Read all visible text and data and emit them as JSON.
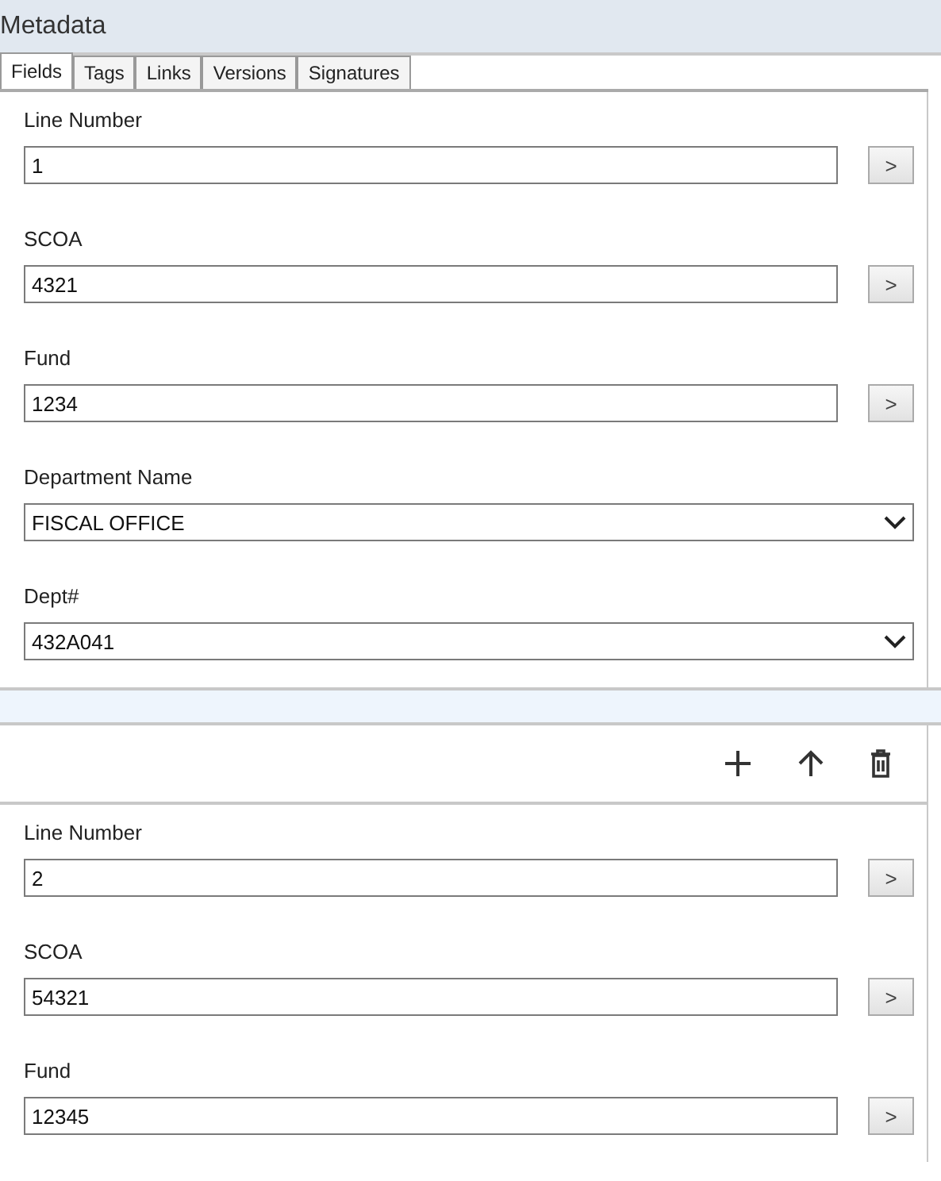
{
  "window": {
    "title": "Metadata"
  },
  "tabs": [
    {
      "label": "Fields",
      "selected": true
    },
    {
      "label": "Tags",
      "selected": false
    },
    {
      "label": "Links",
      "selected": false
    },
    {
      "label": "Versions",
      "selected": false
    },
    {
      "label": "Signatures",
      "selected": false
    }
  ],
  "records": [
    {
      "show_toolbar": false,
      "fields": [
        {
          "label": "Line Number",
          "value": "1",
          "kind": "lookup",
          "button": ">"
        },
        {
          "label": "SCOA",
          "value": "4321",
          "kind": "lookup",
          "button": ">"
        },
        {
          "label": "Fund",
          "value": "1234",
          "kind": "lookup",
          "button": ">"
        },
        {
          "label": "Department Name",
          "value": "FISCAL OFFICE",
          "kind": "dropdown"
        },
        {
          "label": "Dept#",
          "value": "432A041",
          "kind": "dropdown"
        }
      ]
    },
    {
      "show_toolbar": true,
      "fields": [
        {
          "label": "Line Number",
          "value": "2",
          "kind": "lookup",
          "button": ">"
        },
        {
          "label": "SCOA",
          "value": "54321",
          "kind": "lookup",
          "button": ">"
        },
        {
          "label": "Fund",
          "value": "12345",
          "kind": "lookup",
          "button": ">"
        }
      ]
    }
  ]
}
